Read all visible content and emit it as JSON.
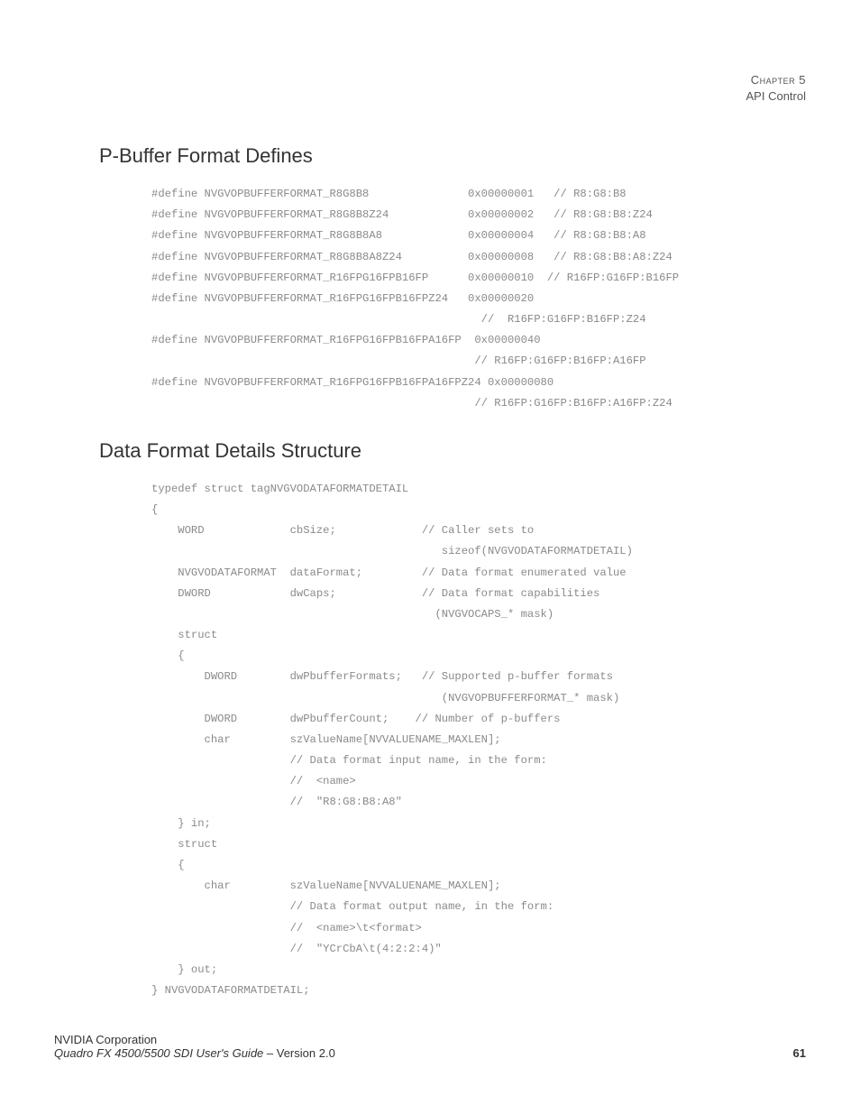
{
  "header": {
    "chapter_label": "Chapter 5",
    "chapter_title": "API Control"
  },
  "sections": {
    "pbuffer": {
      "heading": "P-Buffer Format Defines",
      "code": "#define NVGVOPBUFFERFORMAT_R8G8B8               0x00000001   // R8:G8:B8\n#define NVGVOPBUFFERFORMAT_R8G8B8Z24            0x00000002   // R8:G8:B8:Z24\n#define NVGVOPBUFFERFORMAT_R8G8B8A8             0x00000004   // R8:G8:B8:A8\n#define NVGVOPBUFFERFORMAT_R8G8B8A8Z24          0x00000008   // R8:G8:B8:A8:Z24\n#define NVGVOPBUFFERFORMAT_R16FPG16FPB16FP      0x00000010  // R16FP:G16FP:B16FP\n#define NVGVOPBUFFERFORMAT_R16FPG16FPB16FPZ24   0x00000020\n                                                  //  R16FP:G16FP:B16FP:Z24\n#define NVGVOPBUFFERFORMAT_R16FPG16FPB16FPA16FP  0x00000040\n                                                 // R16FP:G16FP:B16FP:A16FP\n#define NVGVOPBUFFERFORMAT_R16FPG16FPB16FPA16FPZ24 0x00000080\n                                                 // R16FP:G16FP:B16FP:A16FP:Z24"
    },
    "dataformat": {
      "heading": "Data Format Details Structure",
      "code": "typedef struct tagNVGVODATAFORMATDETAIL\n{\n    WORD             cbSize;             // Caller sets to\n                                            sizeof(NVGVODATAFORMATDETAIL)\n    NVGVODATAFORMAT  dataFormat;         // Data format enumerated value\n    DWORD            dwCaps;             // Data format capabilities\n                                           (NVGVOCAPS_* mask)\n    struct\n    {\n        DWORD        dwPbufferFormats;   // Supported p-buffer formats\n                                            (NVGVOPBUFFERFORMAT_* mask)\n        DWORD        dwPbufferCount;    // Number of p-buffers\n        char         szValueName[NVVALUENAME_MAXLEN];\n                     // Data format input name, in the form:\n                     //  <name>\n                     //  \"R8:G8:B8:A8\"\n    } in;\n    struct\n    {\n        char         szValueName[NVVALUENAME_MAXLEN];\n                     // Data format output name, in the form:\n                     //  <name>\\t<format>\n                     //  \"YCrCbA\\t(4:2:2:4)\"\n    } out;\n} NVGVODATAFORMATDETAIL;"
    }
  },
  "footer": {
    "company": "NVIDIA Corporation",
    "doc_title": "Quadro FX 4500/5500 SDI User's Guide",
    "version_sep": " – ",
    "version": "Version 2.0",
    "page_number": "61"
  }
}
